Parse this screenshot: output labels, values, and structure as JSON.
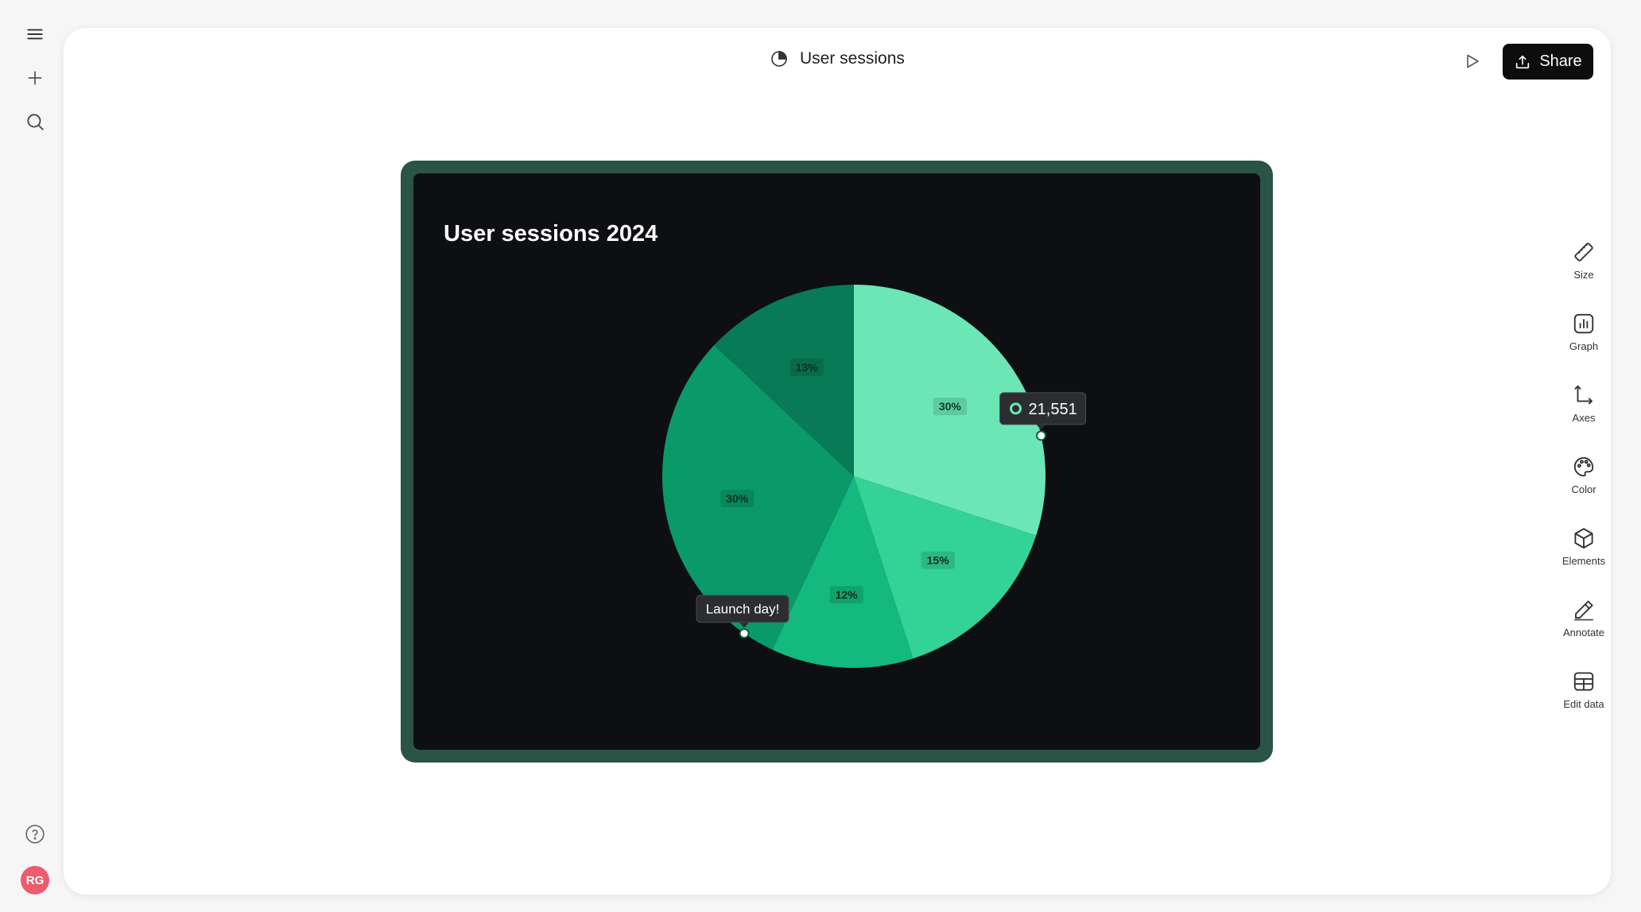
{
  "app": {
    "doc_title": "User sessions",
    "share_label": "Share",
    "user_initials": "RG"
  },
  "tools": [
    {
      "name": "size",
      "label": "Size",
      "icon": "ruler-icon"
    },
    {
      "name": "graph",
      "label": "Graph",
      "icon": "bar-chart-icon"
    },
    {
      "name": "axes",
      "label": "Axes",
      "icon": "axes-icon"
    },
    {
      "name": "color",
      "label": "Color",
      "icon": "palette-icon"
    },
    {
      "name": "elements",
      "label": "Elements",
      "icon": "cube-icon"
    },
    {
      "name": "annotate",
      "label": "Annotate",
      "icon": "pencil-icon"
    },
    {
      "name": "edit-data",
      "label": "Edit data",
      "icon": "table-icon"
    }
  ],
  "chart_data": {
    "type": "pie",
    "title": "User sessions 2024",
    "slices": [
      {
        "label": "30%",
        "value": 30,
        "color": "#6ce6b5"
      },
      {
        "label": "15%",
        "value": 15,
        "color": "#33d296"
      },
      {
        "label": "12%",
        "value": 12,
        "color": "#13b97e"
      },
      {
        "label": "30%",
        "value": 30,
        "color": "#0a9969"
      },
      {
        "label": "13%",
        "value": 13,
        "color": "#087a55"
      }
    ],
    "tooltip": {
      "value": "21,551",
      "slice_index": 0
    },
    "annotation": {
      "text": "Launch day!",
      "slice_index": 3
    }
  }
}
